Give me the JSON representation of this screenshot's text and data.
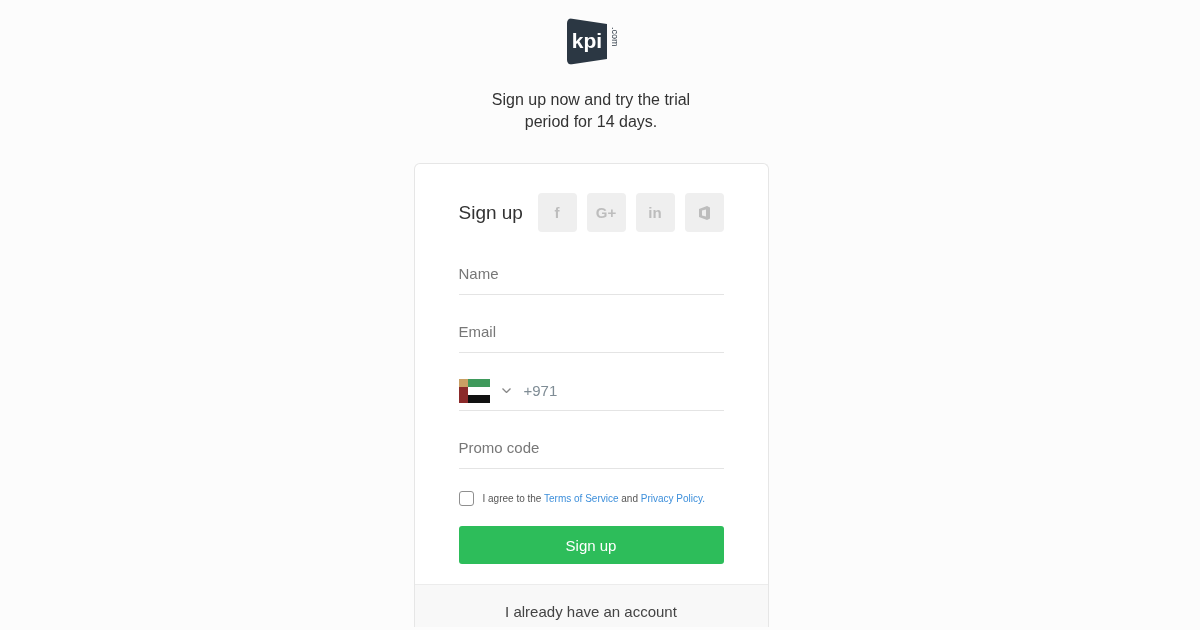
{
  "logo": {
    "mark": "kpi",
    "suffix": ".com"
  },
  "tagline": "Sign up now and try the trial period for 14 days.",
  "form": {
    "title": "Sign up",
    "social": [
      {
        "kind": "letter",
        "glyph": "f"
      },
      {
        "kind": "letter",
        "glyph": "G+"
      },
      {
        "kind": "letter",
        "glyph": "in"
      },
      {
        "kind": "office"
      }
    ],
    "fields": [
      {
        "kind": "text",
        "placeholder": "Name"
      },
      {
        "kind": "text",
        "placeholder": "Email"
      },
      {
        "kind": "phone",
        "value": "+971"
      },
      {
        "kind": "text",
        "placeholder": "Promo code"
      }
    ],
    "agreement": {
      "checked": false,
      "parts": [
        {
          "kind": "text",
          "text": "I agree to the"
        },
        {
          "kind": "link",
          "text": "Terms of Service"
        },
        {
          "kind": "text",
          "text": "and"
        },
        {
          "kind": "link",
          "text": "Privacy Policy."
        }
      ]
    },
    "submit": "Sign up"
  },
  "footer": {
    "link": "I already have an account"
  }
}
